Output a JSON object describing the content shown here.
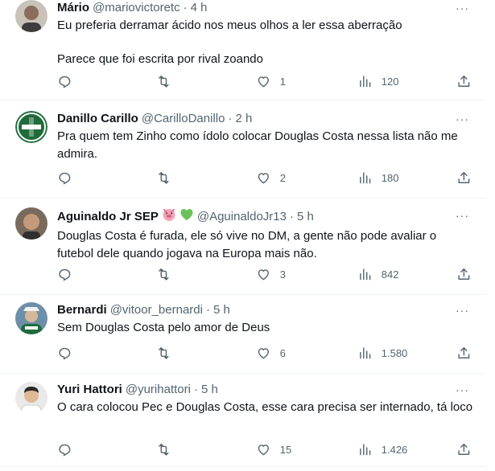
{
  "tweets": [
    {
      "name": "Mário",
      "handle": "@mariovictoretc",
      "time": "4 h",
      "lines": [
        "Eu preferia derramar ácido nos meus olhos a ler essa aberração",
        "Parece que foi escrita por rival zoando"
      ],
      "likes": "1",
      "views": "120",
      "avatar_icon": "user-photo-avatar"
    },
    {
      "name": "Danillo Carillo",
      "handle": "@CarilloDanillo",
      "time": "2 h",
      "lines": [
        "Pra quem tem Zinho como ídolo colocar Douglas Costa nessa lista não me admira."
      ],
      "likes": "2",
      "views": "180",
      "avatar_icon": "palmeiras-crest-avatar"
    },
    {
      "name": "Aguinaldo Jr SEP",
      "handle": "@AguinaldoJr13",
      "time": "5 h",
      "lines": [
        "Douglas Costa é furada, ele só vive no DM, a gente não pode avaliar o futebol dele quando jogava na Europa mais não."
      ],
      "likes": "3",
      "views": "842",
      "name_emojis": [
        "pig-face-icon",
        "green-heart-icon"
      ],
      "avatar_icon": "user-photo-avatar"
    },
    {
      "name": "Bernardi",
      "handle": "@vitoor_bernardi",
      "time": "5 h",
      "lines": [
        "Sem Douglas Costa pelo amor de Deus"
      ],
      "likes": "6",
      "views": "1.580",
      "avatar_icon": "user-photo-avatar"
    },
    {
      "name": "Yuri Hattori",
      "handle": "@yurihattori",
      "time": "5 h",
      "lines": [
        "O cara colocou Pec e Douglas Costa, esse cara precisa ser internado, tá loco"
      ],
      "likes": "15",
      "views": "1.426",
      "avatar_icon": "user-photo-avatar"
    }
  ],
  "separator": "·",
  "more_label": "···",
  "colors": {
    "text": "#0f1419",
    "muted": "#536471",
    "divider": "#eff3f4",
    "heart": "#6bc25b",
    "pig": "#f4a5b8"
  }
}
